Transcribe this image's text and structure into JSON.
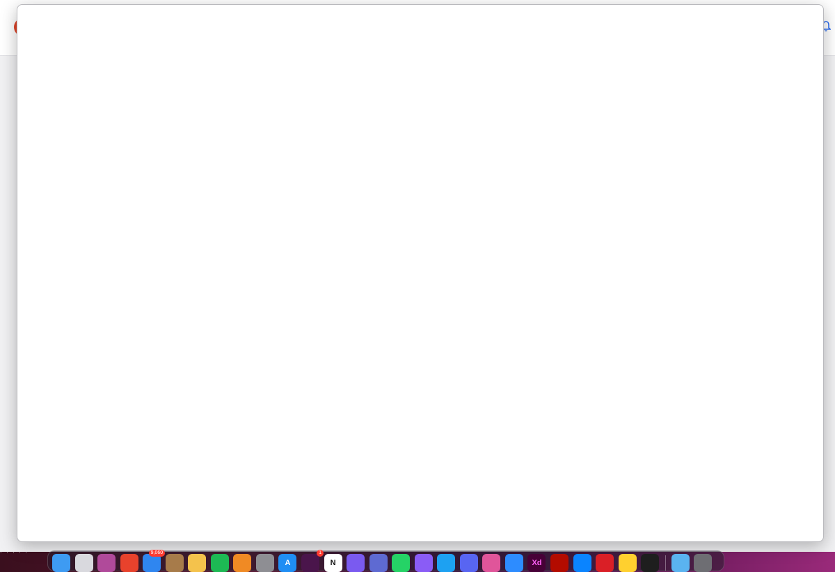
{
  "background_window": {
    "footer_text": "·  ·  ·  ·  ·"
  },
  "modal": {
    "state": "blank"
  },
  "dock": {
    "items": [
      {
        "name": "finder",
        "icon": "finder-icon",
        "color": "#3e9bf2",
        "glyph": ""
      },
      {
        "name": "launchpad",
        "icon": "launchpad-icon",
        "color": "#d9d9de",
        "glyph": ""
      },
      {
        "name": "affinity",
        "icon": "affinity-icon",
        "color": "#b04a9a",
        "glyph": ""
      },
      {
        "name": "calendar",
        "icon": "calendar-icon",
        "color": "#e8422c",
        "glyph": ""
      },
      {
        "name": "mail",
        "icon": "mail-icon",
        "color": "#2f86f0",
        "glyph": "",
        "badge": "9,060"
      },
      {
        "name": "tot",
        "icon": "notes-app-icon",
        "color": "#a77b4a",
        "glyph": ""
      },
      {
        "name": "photos",
        "icon": "photos-icon",
        "color": "#f4c24c",
        "glyph": ""
      },
      {
        "name": "spotify",
        "icon": "spotify-icon",
        "color": "#1db954",
        "glyph": ""
      },
      {
        "name": "books",
        "icon": "books-icon",
        "color": "#f08a24",
        "glyph": ""
      },
      {
        "name": "system-settings",
        "icon": "gear-icon",
        "color": "#8e8e93",
        "glyph": ""
      },
      {
        "name": "app-store",
        "icon": "app-store-icon",
        "color": "#1f8ef4",
        "glyph": "A"
      },
      {
        "name": "slack",
        "icon": "slack-icon",
        "color": "#4a154b",
        "glyph": "",
        "badge": "1"
      },
      {
        "name": "notion",
        "icon": "notion-icon",
        "color": "#ffffff",
        "glyph": "N"
      },
      {
        "name": "obsidian",
        "icon": "obsidian-icon",
        "color": "#7a5af0",
        "glyph": ""
      },
      {
        "name": "linear",
        "icon": "linear-icon",
        "color": "#5e6ad2",
        "glyph": ""
      },
      {
        "name": "whatsapp",
        "icon": "whatsapp-icon",
        "color": "#25d366",
        "glyph": ""
      },
      {
        "name": "messenger",
        "icon": "messenger-icon",
        "color": "#8a5cf6",
        "glyph": ""
      },
      {
        "name": "twitter",
        "icon": "twitter-icon",
        "color": "#1da1f2",
        "glyph": ""
      },
      {
        "name": "discord",
        "icon": "discord-icon",
        "color": "#5865f2",
        "glyph": ""
      },
      {
        "name": "arc",
        "icon": "arc-browser-icon",
        "color": "#e0559a",
        "glyph": ""
      },
      {
        "name": "zoom",
        "icon": "zoom-icon",
        "color": "#2d8cff",
        "glyph": ""
      },
      {
        "name": "adobe-xd",
        "icon": "adobe-xd-icon",
        "color": "#470137",
        "glyph": "Xd"
      },
      {
        "name": "acrobat",
        "icon": "acrobat-icon",
        "color": "#b30b00",
        "glyph": ""
      },
      {
        "name": "framer",
        "icon": "framer-icon",
        "color": "#0a84ff",
        "glyph": ""
      },
      {
        "name": "creative-cloud",
        "icon": "creative-cloud-icon",
        "color": "#da1f26",
        "glyph": ""
      },
      {
        "name": "miro",
        "icon": "miro-icon",
        "color": "#ffd02f",
        "glyph": ""
      },
      {
        "name": "figma",
        "icon": "figma-icon",
        "color": "#1e1e1e",
        "glyph": ""
      }
    ],
    "trailing_items": [
      {
        "name": "downloads-folder",
        "icon": "folder-icon",
        "color": "#5ab3f0",
        "glyph": ""
      },
      {
        "name": "trash",
        "icon": "trash-icon",
        "color": "#6e6e73",
        "glyph": ""
      }
    ]
  }
}
